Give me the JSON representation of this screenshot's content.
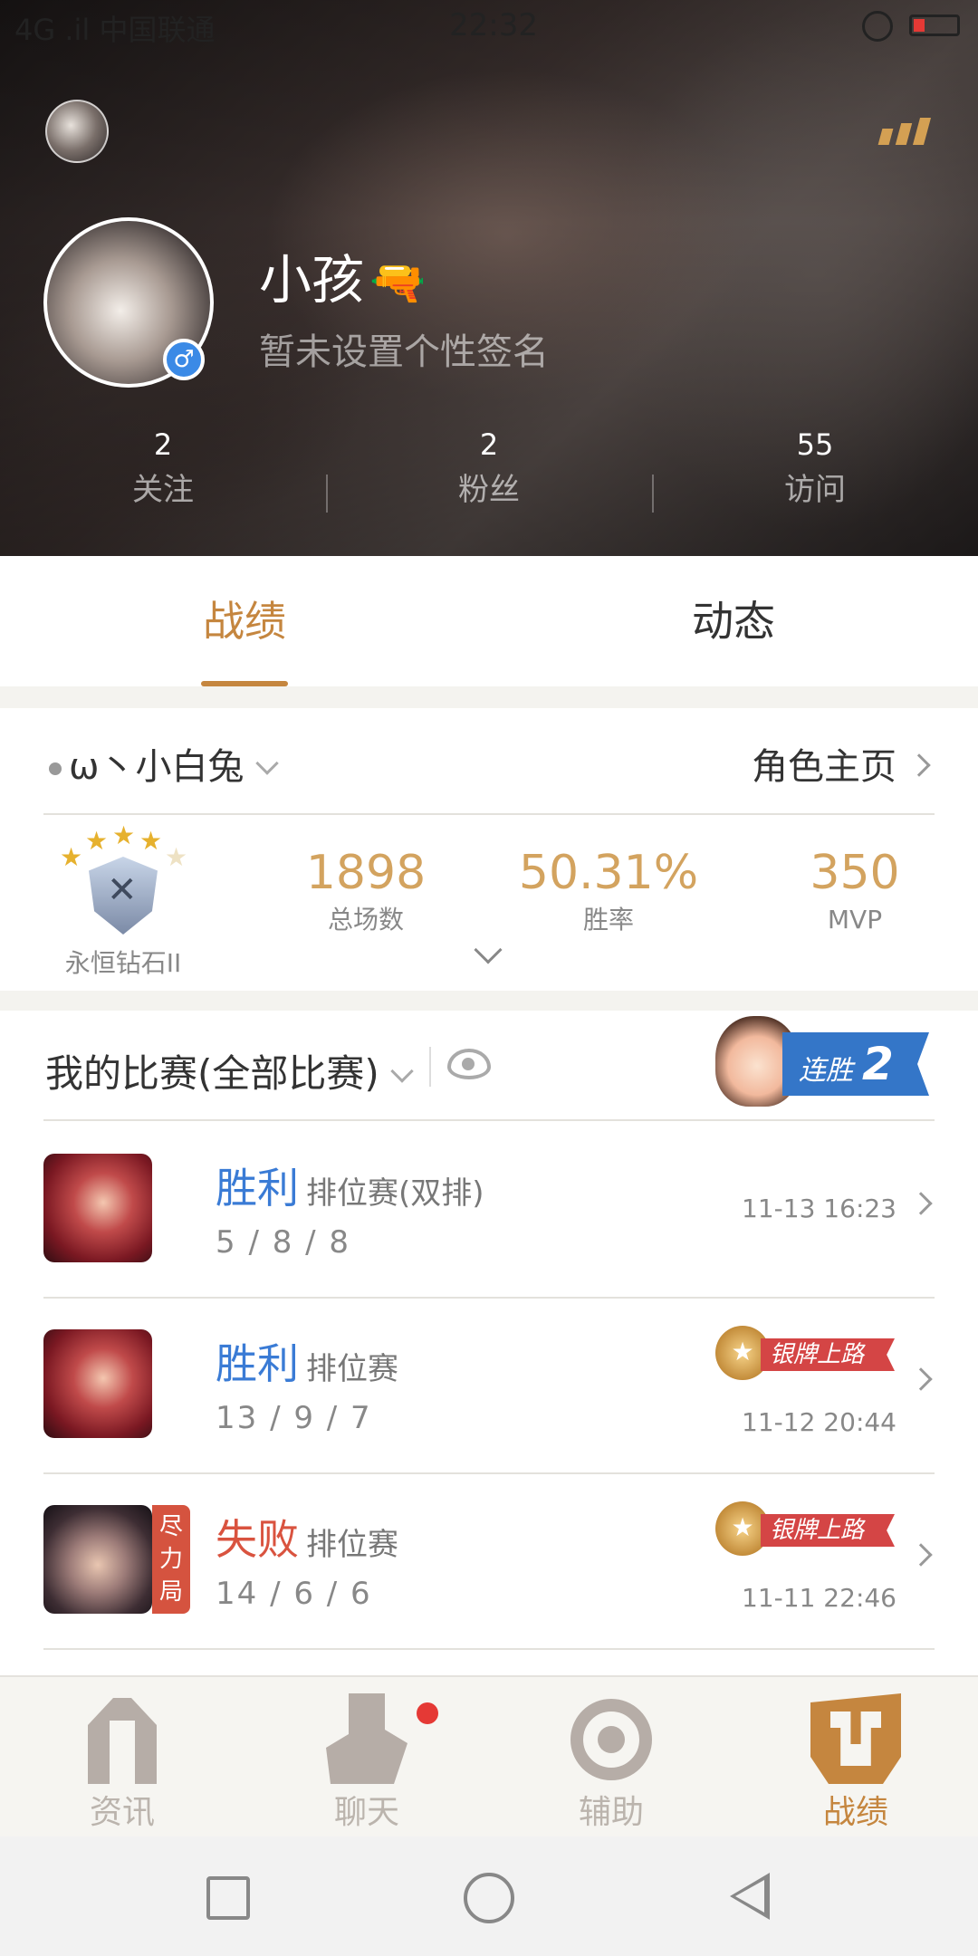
{
  "status_bar": {
    "carrier": "4G .il 中国联通",
    "time": "22:32"
  },
  "profile": {
    "nickname": "小孩",
    "nickname_emoji": "🔫",
    "signature": "暂未设置个性签名",
    "gender_symbol": "♂",
    "stats": [
      {
        "value": "2",
        "label": "关注"
      },
      {
        "value": "2",
        "label": "粉丝"
      },
      {
        "value": "55",
        "label": "访问"
      }
    ]
  },
  "tabs": [
    {
      "label": "战绩",
      "active": true
    },
    {
      "label": "动态",
      "active": false
    }
  ],
  "role": {
    "name": "ω丶小白兔",
    "home_link": "角色主页",
    "rank_label": "永恒钻石II",
    "stars": 4,
    "metrics": [
      {
        "value": "1898",
        "label": "总场数"
      },
      {
        "value": "50.31%",
        "label": "胜率"
      },
      {
        "value": "350",
        "label": "MVP"
      }
    ]
  },
  "matches": {
    "title": "我的比赛(全部比赛)",
    "streak_label": "连胜",
    "streak_count": "2",
    "items": [
      {
        "result": "胜利",
        "mode": "排位赛(双排)",
        "kda": "5 / 8 / 8",
        "date": "11-13 16:23",
        "badge": "",
        "tag": ""
      },
      {
        "result": "胜利",
        "mode": "排位赛",
        "kda": "13 / 9 / 7",
        "date": "11-12 20:44",
        "badge": "银牌上路",
        "tag": ""
      },
      {
        "result": "失败",
        "mode": "排位赛",
        "kda": "14 / 6 / 6",
        "date": "11-11 22:46",
        "badge": "银牌上路",
        "tag": "尽\n力\n局"
      }
    ]
  },
  "bottom_nav": [
    {
      "label": "资讯",
      "icon": "news-icon",
      "active": false
    },
    {
      "label": "聊天",
      "icon": "chat-icon",
      "active": false
    },
    {
      "label": "辅助",
      "icon": "assist-icon",
      "active": false
    },
    {
      "label": "战绩",
      "icon": "record-icon",
      "active": true
    }
  ],
  "colors": {
    "accent": "#c5863f",
    "win": "#3a7bd5",
    "lose": "#d9533f",
    "metric": "#d3a35f"
  }
}
